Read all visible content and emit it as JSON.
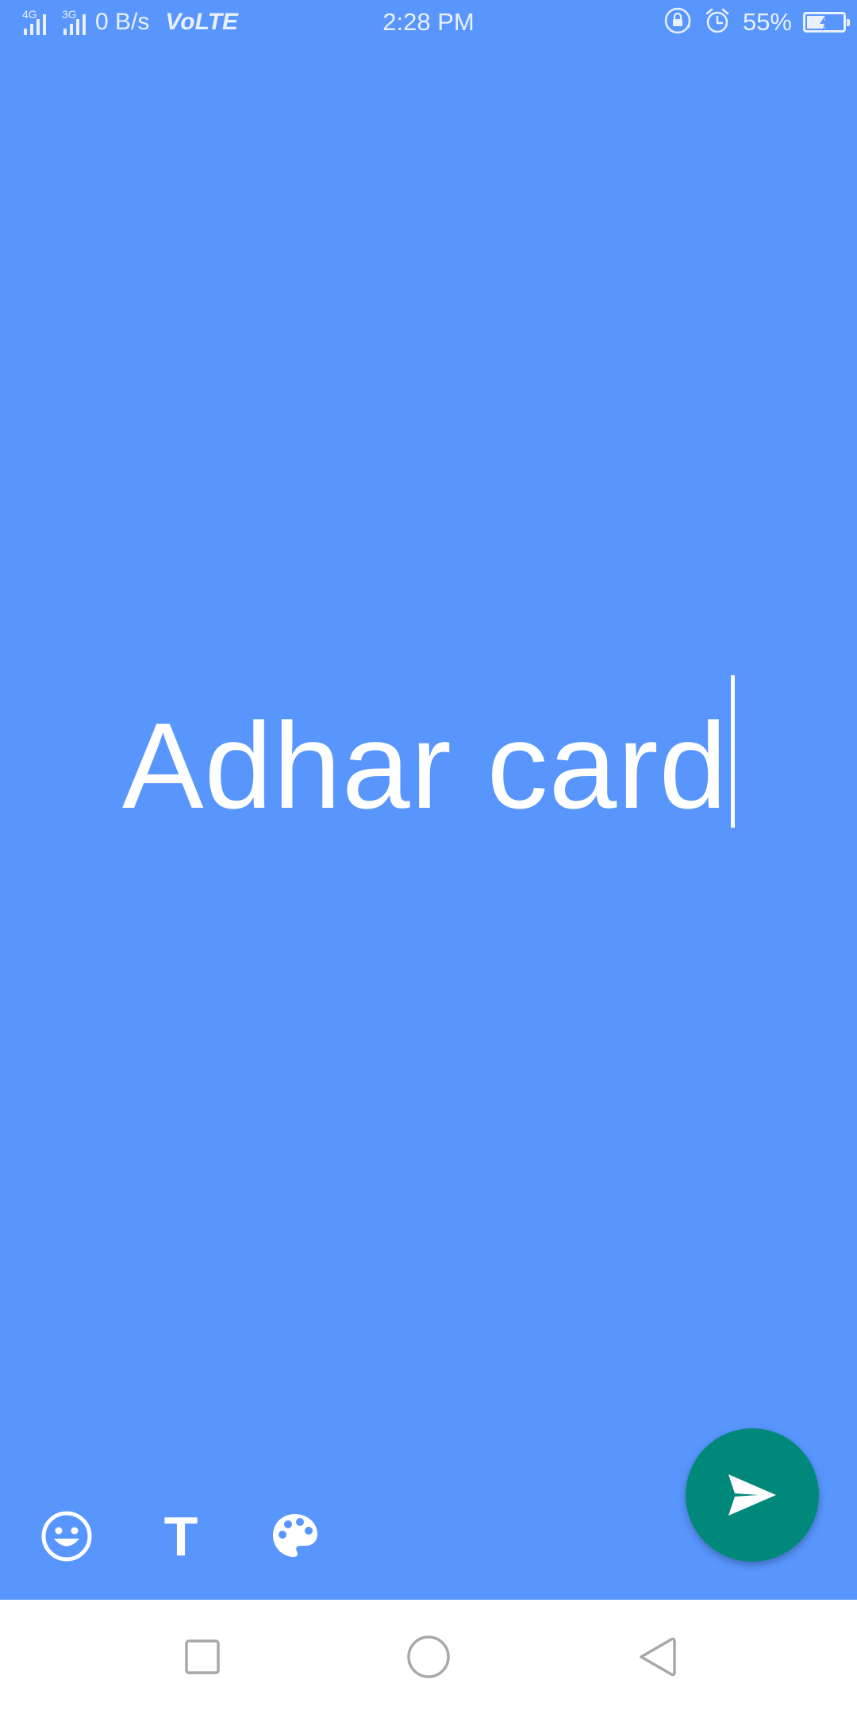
{
  "status_bar": {
    "network_1": "4G",
    "network_2": "3G",
    "data_speed": "0 B/s",
    "volte": "VoLTE",
    "time": "2:28 PM",
    "battery_percent": "55%",
    "battery_level": 0.55,
    "icons": [
      "signal-icon",
      "rotation-lock-icon",
      "alarm-icon",
      "battery-charging-icon"
    ]
  },
  "editor": {
    "text": "Adhar card",
    "text_color": "#ffffff",
    "background_color": "#5896fe"
  },
  "toolbar": {
    "emoji_icon": "emoji-icon",
    "text_style_glyph": "T",
    "palette_icon": "palette-icon"
  },
  "send_button": {
    "icon": "send-icon",
    "color": "#00897b"
  },
  "nav_bar": {
    "icons": [
      "recents-square-icon",
      "home-circle-icon",
      "back-triangle-icon"
    ]
  }
}
